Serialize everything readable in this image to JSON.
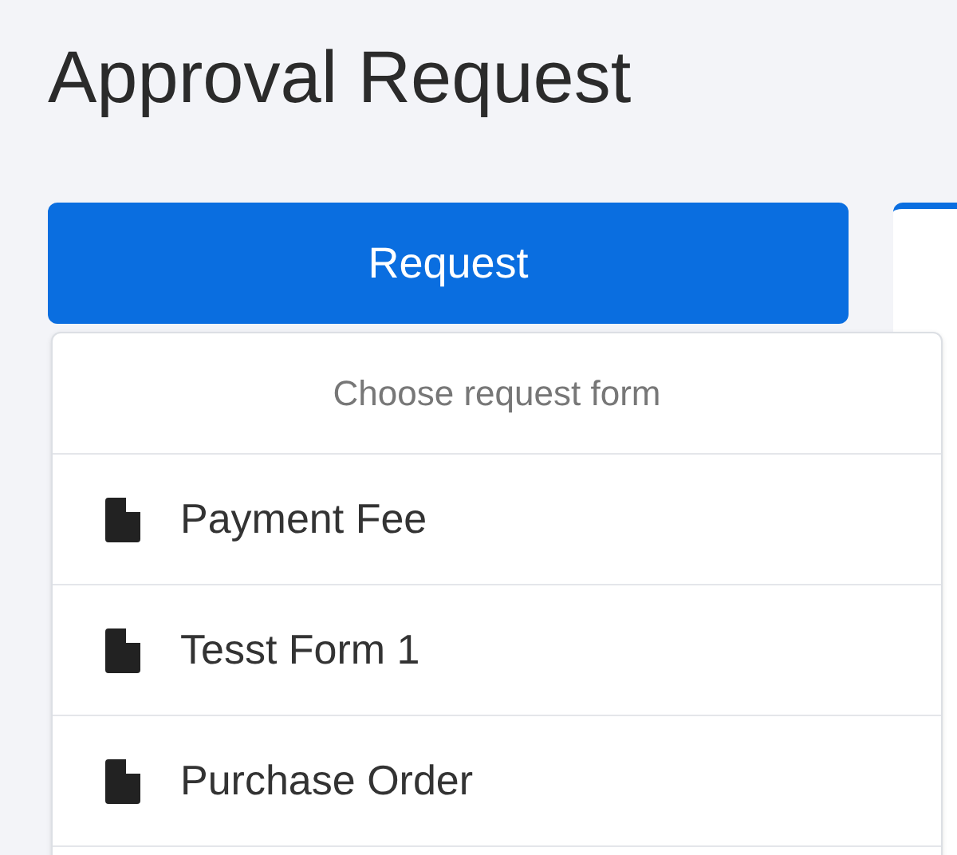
{
  "page": {
    "title": "Approval Request"
  },
  "request_button": {
    "label": "Request",
    "expanded": true
  },
  "dropdown": {
    "header": "Choose request form",
    "items": [
      {
        "label": "Payment Fee"
      },
      {
        "label": "Tesst Form 1"
      },
      {
        "label": "Purchase Order"
      }
    ]
  }
}
